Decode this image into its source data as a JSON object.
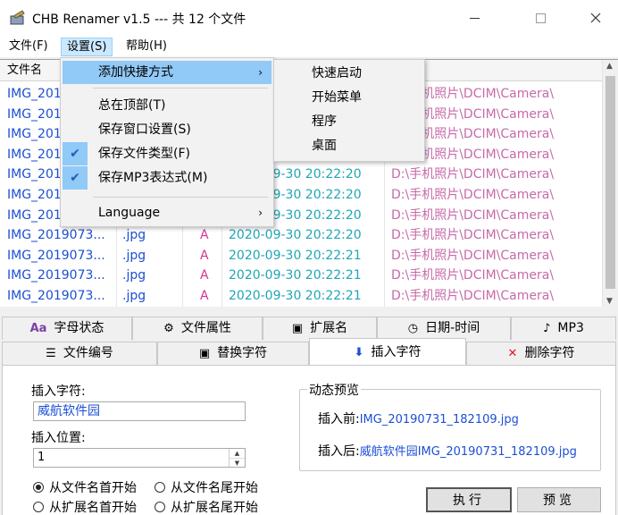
{
  "window": {
    "title": "CHB Renamer v1.5 --- 共 12 个文件"
  },
  "menubar": [
    "文件(F)",
    "设置(S)",
    "帮助(H)"
  ],
  "list": {
    "headers": [
      "文件名"
    ],
    "rows": [
      {
        "name": "IMG_201",
        "ext": "",
        "attr": "",
        "time": "",
        "path": "D:\\手机照片\\DCIM\\Camera\\"
      },
      {
        "name": "IMG_201",
        "ext": "",
        "attr": "",
        "time": "",
        "path": "D:\\手机照片\\DCIM\\Camera\\"
      },
      {
        "name": "IMG_201",
        "ext": "",
        "attr": "",
        "time": "",
        "path": "D:\\手机照片\\DCIM\\Camera\\"
      },
      {
        "name": "IMG_201",
        "ext": "",
        "attr": "",
        "time": "",
        "path": "D:\\手机照片\\DCIM\\Camera\\"
      },
      {
        "name": "IMG_201",
        "ext": "",
        "attr": "",
        "time": "2020-09-30 20:22:20",
        "path": "D:\\手机照片\\DCIM\\Camera\\"
      },
      {
        "name": "IMG_201",
        "ext": "",
        "attr": "",
        "time": "2020-09-30 20:22:20",
        "path": "D:\\手机照片\\DCIM\\Camera\\"
      },
      {
        "name": "IMG_201",
        "ext": "",
        "attr": "",
        "time": "2020-09-30 20:22:20",
        "path": "D:\\手机照片\\DCIM\\Camera\\"
      },
      {
        "name": "IMG_2019073...",
        "ext": ".jpg",
        "attr": "A",
        "time": "2020-09-30 20:22:20",
        "path": "D:\\手机照片\\DCIM\\Camera\\"
      },
      {
        "name": "IMG_2019073...",
        "ext": ".jpg",
        "attr": "A",
        "time": "2020-09-30 20:22:21",
        "path": "D:\\手机照片\\DCIM\\Camera\\"
      },
      {
        "name": "IMG_2019073...",
        "ext": ".jpg",
        "attr": "A",
        "time": "2020-09-30 20:22:21",
        "path": "D:\\手机照片\\DCIM\\Camera\\"
      },
      {
        "name": "IMG_2019073...",
        "ext": ".jpg",
        "attr": "A",
        "time": "2020-09-30 20:22:21",
        "path": "D:\\手机照片\\DCIM\\Camera\\"
      }
    ]
  },
  "settings_menu": {
    "items": [
      {
        "label": "添加快捷方式",
        "checked": false,
        "submenu": true
      },
      {
        "label": "总在顶部(T)",
        "checked": false
      },
      {
        "label": "保存窗口设置(S)",
        "checked": false
      },
      {
        "label": "保存文件类型(F)",
        "checked": true
      },
      {
        "label": "保存MP3表达式(M)",
        "checked": true
      },
      {
        "label": "Language",
        "checked": false,
        "submenu": true
      }
    ],
    "check_glyph": "✔",
    "arrow_glyph": "›"
  },
  "shortcut_submenu": [
    "快速启动",
    "开始菜单",
    "程序",
    "桌面"
  ],
  "tabs_row1": [
    {
      "label": "字母状态",
      "icon": "Aa"
    },
    {
      "label": "文件属性",
      "icon": "⚙"
    },
    {
      "label": "扩展名",
      "icon": "▣"
    },
    {
      "label": "日期-时间",
      "icon": "◷"
    },
    {
      "label": "MP3",
      "icon": "♪"
    }
  ],
  "tabs_row2": [
    {
      "label": "文件编号",
      "icon": "☰"
    },
    {
      "label": "替换字符",
      "icon": "▣"
    },
    {
      "label": "插入字符",
      "icon": "⬇"
    },
    {
      "label": "删除字符",
      "icon": "✕"
    }
  ],
  "insert_panel": {
    "insert_char_label": "插入字符:",
    "insert_char_value": "威航软件园",
    "insert_pos_label": "插入位置:",
    "insert_pos_value": "1",
    "radios": [
      {
        "label": "从文件名首开始",
        "checked": true
      },
      {
        "label": "从文件名尾开始",
        "checked": false
      },
      {
        "label": "从扩展名首开始",
        "checked": false
      },
      {
        "label": "从扩展名尾开始",
        "checked": false
      }
    ],
    "preview_title": "动态预览",
    "before_label": "插入前:",
    "before_value": "IMG_20190731_182109.jpg",
    "after_label": "插入后:",
    "after_value": "威航软件园IMG_20190731_182109.jpg",
    "execute_label": "执行",
    "preview_label": "预览"
  },
  "colors": {
    "filename": "#1c4fd4",
    "attr": "#d3358f",
    "time": "#1fa6b5",
    "path": "#c76aa8",
    "menu_highlight": "#91c9f7",
    "close_icon": "#e81123"
  }
}
